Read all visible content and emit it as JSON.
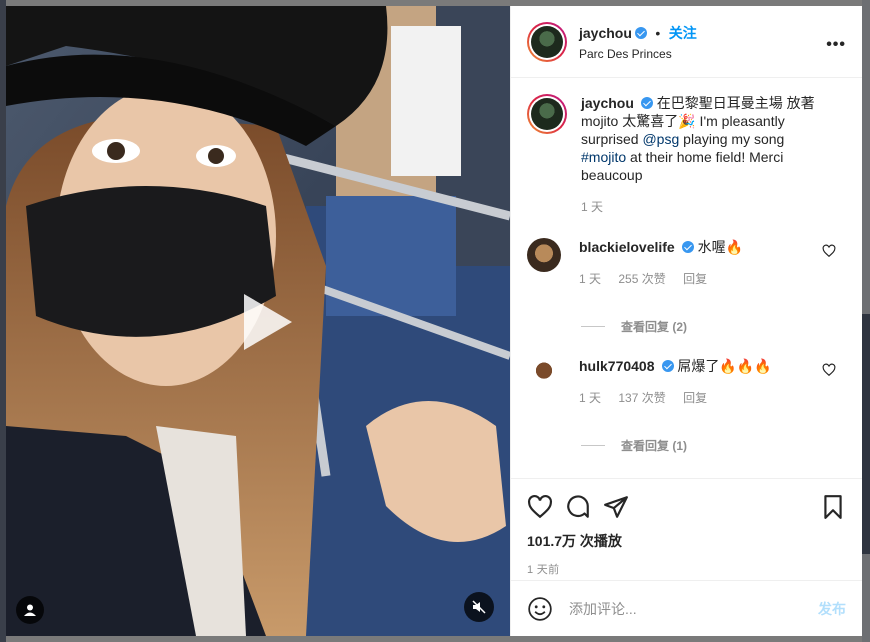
{
  "post": {
    "username": "jaychou",
    "follow_label": "关注",
    "dot": "•",
    "location": "Parc Des Princes",
    "more_label": "•••"
  },
  "caption": {
    "username": "jaychou",
    "text_before": "在巴黎聖日耳曼主場 放著 mojito 太驚喜了🎉 I'm pleasantly surprised ",
    "mention": "@psg",
    "text_middle": " playing my song ",
    "hashtag": "#mojito",
    "text_after": " at their home field! Merci beaucoup",
    "time": "1 天"
  },
  "comments": [
    {
      "username": "blackielovelife",
      "text": "水喔🔥",
      "time": "1 天",
      "likes": "255 次赞",
      "reply": "回复",
      "view_replies": "查看回复 (2)"
    },
    {
      "username": "hulk770408",
      "text": "屌爆了🔥🔥🔥",
      "time": "1 天",
      "likes": "137 次赞",
      "reply": "回复",
      "view_replies": "查看回复 (1)"
    }
  ],
  "stats": {
    "views": "101.7万 次播放",
    "posted": "1 天前"
  },
  "composer": {
    "placeholder": "添加评论...",
    "post_label": "发布"
  },
  "icons": {
    "like": "heart-icon",
    "comment": "comment-icon",
    "share": "share-icon",
    "save": "bookmark-icon",
    "emoji": "emoji-icon",
    "mute": "muted-speaker-icon",
    "play": "play-icon",
    "tagged": "user-icon"
  },
  "colors": {
    "accent": "#0095f6",
    "verified": "#3897f0",
    "post_disabled": "#b2dffc",
    "muted_text": "#8e8e8e"
  }
}
